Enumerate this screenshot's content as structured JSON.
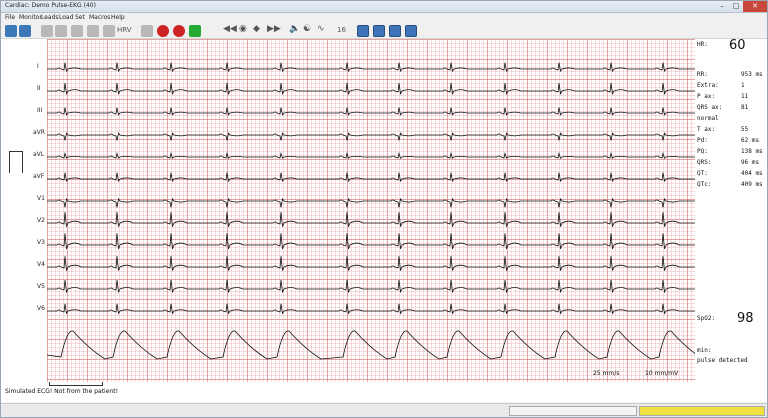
{
  "window": {
    "title": "Cardiac: Demo Pulse-EKG (40)"
  },
  "menu": [
    "File",
    "Monitor",
    "Leads",
    "Load",
    "Set",
    "Macros",
    "Help"
  ],
  "toolbar": {
    "hrv_label": "HRV",
    "scale_label": "16"
  },
  "leads": [
    "I",
    "II",
    "III",
    "aVR",
    "aVL",
    "aVF",
    "V1",
    "V2",
    "V3",
    "V4",
    "V5",
    "V6"
  ],
  "measurements": {
    "hr_label": "HR:",
    "hr_value": "60",
    "rows": [
      {
        "label": "RR:",
        "value": "953 ms"
      },
      {
        "label": "Extra:",
        "value": "1"
      },
      {
        "label": "P ax:",
        "value": "11"
      },
      {
        "label": "QRS ax:",
        "value": "81"
      },
      {
        "label": "normal",
        "value": ""
      },
      {
        "label": "T ax:",
        "value": "55"
      },
      {
        "label": "Pd:",
        "value": "62 ms"
      },
      {
        "label": "PQ:",
        "value": "138 ms"
      },
      {
        "label": "QRS:",
        "value": "96 ms"
      },
      {
        "label": "QT:",
        "value": "404 ms"
      },
      {
        "label": "QTc:",
        "value": "409 ms"
      }
    ],
    "spo2_label": "SpO2:",
    "spo2_value": "98",
    "pulse_label": "min:",
    "pulse_status": "pulse detected"
  },
  "scale": {
    "speed": "25 mm/s",
    "gain": "10 mm/mV"
  },
  "footer": {
    "warning": "Simulated ECG! Not from the patient!"
  },
  "colors": {
    "grid_major": "#d27878",
    "grid_minor": "#f0bebe",
    "trace": "#111111",
    "progress": "#f0e040"
  }
}
